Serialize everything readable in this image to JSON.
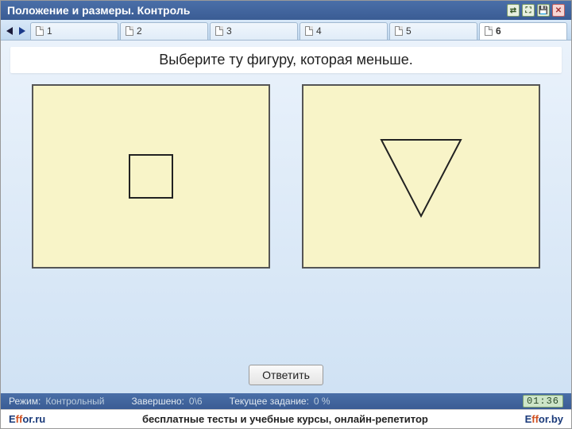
{
  "title": "Положение и размеры. Контроль",
  "tabs": [
    {
      "label": "1"
    },
    {
      "label": "2"
    },
    {
      "label": "3"
    },
    {
      "label": "4"
    },
    {
      "label": "5"
    },
    {
      "label": "6"
    }
  ],
  "active_tab": 5,
  "question": "Выберите  ту  фигуру,  которая  меньше.",
  "answer_button": "Ответить",
  "status": {
    "mode_label": "Режим:",
    "mode_value": "Контрольный",
    "done_label": "Завершено:",
    "done_value": "0\\6",
    "current_label": "Текущее задание:",
    "current_value": "0 %",
    "timer": "01:36"
  },
  "footer": {
    "brand_prefix": "E",
    "brand_mid": "ff",
    "brand_left_suffix": "or.ru",
    "brand_right_suffix": "or.by",
    "tagline": "бесплатные тесты и учебные курсы, онлайн-репетитор"
  }
}
